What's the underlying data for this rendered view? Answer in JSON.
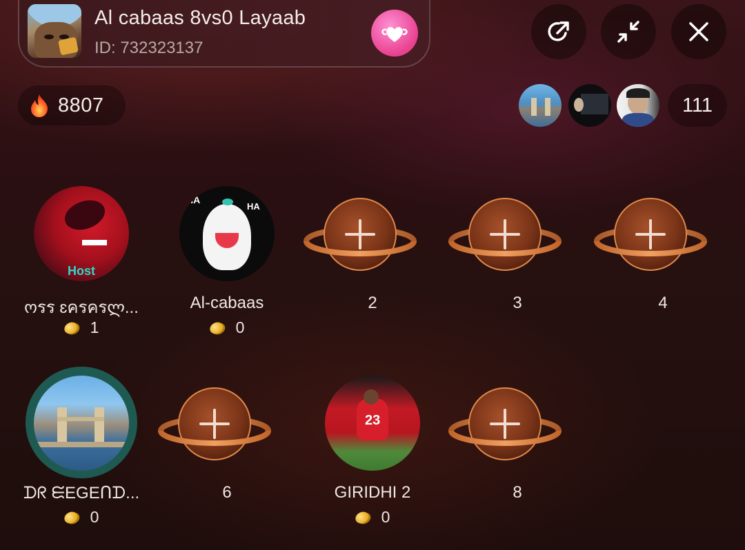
{
  "room": {
    "title": "Al cabaas 8vs0 Layaab",
    "id_text": "ID: 732323137"
  },
  "header_buttons": {
    "share": "share-icon",
    "minimize": "minimize-icon",
    "close": "close-icon"
  },
  "stats": {
    "heat_icon": "flame-icon",
    "heat_value": "8807",
    "viewer_count": "111"
  },
  "colors": {
    "accent_pink": "#e8418f",
    "host_label": "#31d6c9",
    "coin": "#e6a91a"
  },
  "seats": [
    {
      "label": "ოรร ɛครครლ...",
      "coins": "1",
      "host_text": "Host",
      "occupied": true
    },
    {
      "label": "Al-cabaas",
      "coins": "0",
      "occupied": true
    },
    {
      "label": "2",
      "occupied": false
    },
    {
      "label": "3",
      "occupied": false
    },
    {
      "label": "4",
      "occupied": false
    },
    {
      "label": "ᗪᖇ ᙓEGEᑎᗪ...",
      "coins": "0",
      "occupied": true
    },
    {
      "label": "6",
      "occupied": false
    },
    {
      "label": "GIRIDHI 2",
      "coins": "0",
      "occupied": true
    },
    {
      "label": "8",
      "occupied": false
    }
  ]
}
